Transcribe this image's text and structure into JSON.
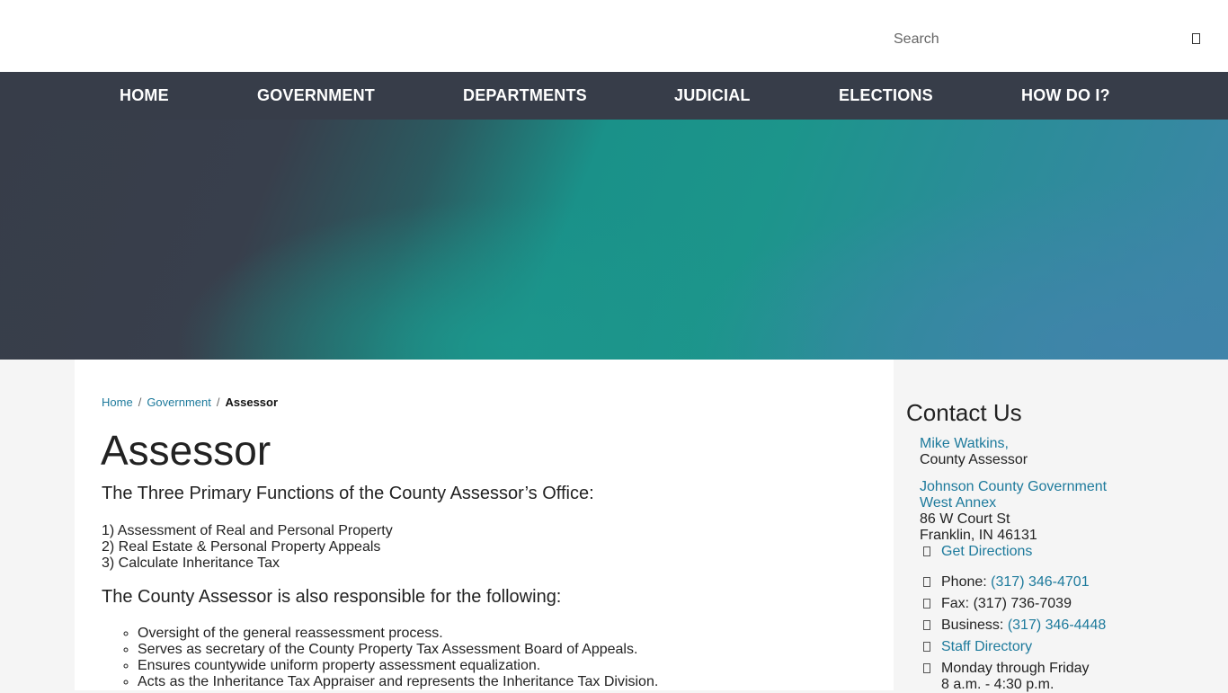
{
  "header": {
    "search": {
      "placeholder": "Search",
      "button_icon": "search-icon"
    }
  },
  "nav": {
    "items": [
      {
        "label": "HOME"
      },
      {
        "label": "GOVERNMENT"
      },
      {
        "label": "DEPARTMENTS"
      },
      {
        "label": "JUDICIAL"
      },
      {
        "label": "ELECTIONS"
      },
      {
        "label": "HOW DO I?"
      }
    ]
  },
  "breadcrumb": {
    "items": [
      {
        "label": "Home"
      },
      {
        "label": "Government"
      }
    ],
    "separator": "/",
    "current": "Assessor"
  },
  "page": {
    "title": "Assessor",
    "subheading1": "The Three Primary Functions of the County Assessor’s Office:",
    "functions": [
      "1) Assessment of Real and Personal Property",
      "2) Real Estate & Personal Property Appeals",
      "3) Calculate Inheritance Tax"
    ],
    "subheading2": "The County Assessor is also responsible for the following:",
    "responsibilities": [
      "Oversight of the general reassessment process.",
      "Serves as secretary of the County Property Tax Assessment Board of Appeals.",
      "Ensures countywide uniform property assessment equalization.",
      "Acts as the Inheritance Tax Appraiser and represents the Inheritance Tax Division."
    ]
  },
  "contact": {
    "title": "Contact Us",
    "person_name": "Mike Watkins,",
    "person_title": "County Assessor",
    "org_line1": "Johnson County Government",
    "org_line2": "West Annex",
    "address1": "86 W Court St",
    "address2": "Franklin, IN 46131",
    "directions": "Get Directions",
    "phone_label": "Phone:",
    "phone": "(317) 346-4701",
    "fax": "Fax: (317) 736-7039",
    "business_label": "Business:",
    "business": "(317) 346-4448",
    "staff_directory": "Staff Directory",
    "hours1": "Monday through Friday",
    "hours2": "8 a.m. - 4:30 p.m."
  },
  "colors": {
    "nav_bg": "#373d49",
    "link": "#1d7a9c",
    "hero_teal": "#1c958b",
    "hero_blue": "#3e85a8"
  }
}
